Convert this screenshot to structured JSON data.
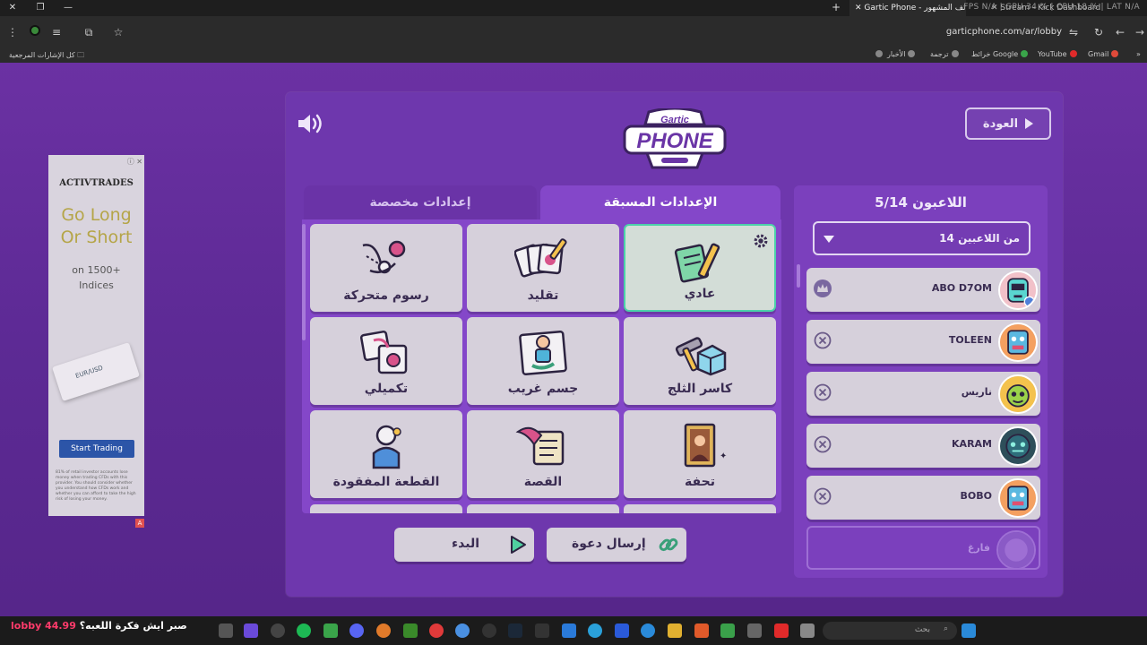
{
  "browser": {
    "tabs": [
      {
        "label": "Gartic Phone - الهاتف المشهور",
        "active": true
      },
      {
        "label": "Stream - Kick Dashboard",
        "active": false
      }
    ],
    "overlay": "FPS N/A  |  GPU 34 %  |  CPU 18 %  |  LAT N/A",
    "url": "garticphone.com/ar/lobby",
    "bookmarks": {
      "all": "كل الإشارات المرجعية",
      "items": [
        "Gmail",
        "YouTube",
        "خرائط Google",
        "ترجمة",
        "الأخبار"
      ]
    }
  },
  "ad": {
    "brand": "ACTIVTRADES",
    "headline_1": "Go Long",
    "headline_2": "Or Short",
    "sub_1": "on 1500+",
    "sub_2": "Indices",
    "card_label": "EUR/USD",
    "cta": "Start Trading",
    "fine_print": "81% of retail investor accounts lose money when trading CFDs with this provider. You should consider whether you understand how CFDs work and whether you can afford to take the high risk of losing your money."
  },
  "lobby": {
    "back_button": "العودة",
    "logo_top": "Gartic",
    "logo_bottom": "PHONE",
    "tabs": {
      "preset": "الإعدادات المسبقة",
      "custom": "إعدادات مخصصة"
    },
    "modes": [
      {
        "label": "عادي",
        "icon": "notepad-pencil-icon"
      },
      {
        "label": "تقليد",
        "icon": "cards-brush-icon"
      },
      {
        "label": "رسوم متحركة",
        "icon": "animation-icon"
      },
      {
        "label": "كاسر الثلج",
        "icon": "icebreaker-icon"
      },
      {
        "label": "جسم غريب",
        "icon": "odd-body-icon"
      },
      {
        "label": "تكميلي",
        "icon": "complement-icon"
      },
      {
        "label": "تحفة",
        "icon": "masterpiece-frame-icon"
      },
      {
        "label": "القصة",
        "icon": "story-scroll-icon"
      },
      {
        "label": "القطعة المفقودة",
        "icon": "missing-piece-icon"
      }
    ],
    "players": {
      "title": "اللاعبون 5/14",
      "max_select": "14 من اللاعبين",
      "list": [
        {
          "name": "ABO D7OM",
          "host": true,
          "color": "#5ad6d0"
        },
        {
          "name": "TOLEEN",
          "host": false,
          "color": "#f0a540"
        },
        {
          "name": "ناريس",
          "host": false,
          "color": "#9bd24a"
        },
        {
          "name": "KARAM",
          "host": false,
          "color": "#2e6d7a"
        },
        {
          "name": "BOBO",
          "host": false,
          "color": "#f0a540"
        }
      ],
      "empty_label": "فارغ"
    },
    "invite_button": "إرسال دعوة",
    "start_button": "البدء"
  },
  "taskbar": {
    "search_placeholder": "بحث",
    "caption_prefix": "صبر ايش فكرة اللعبه؟",
    "caption_highlight": "lobby 44.99"
  }
}
